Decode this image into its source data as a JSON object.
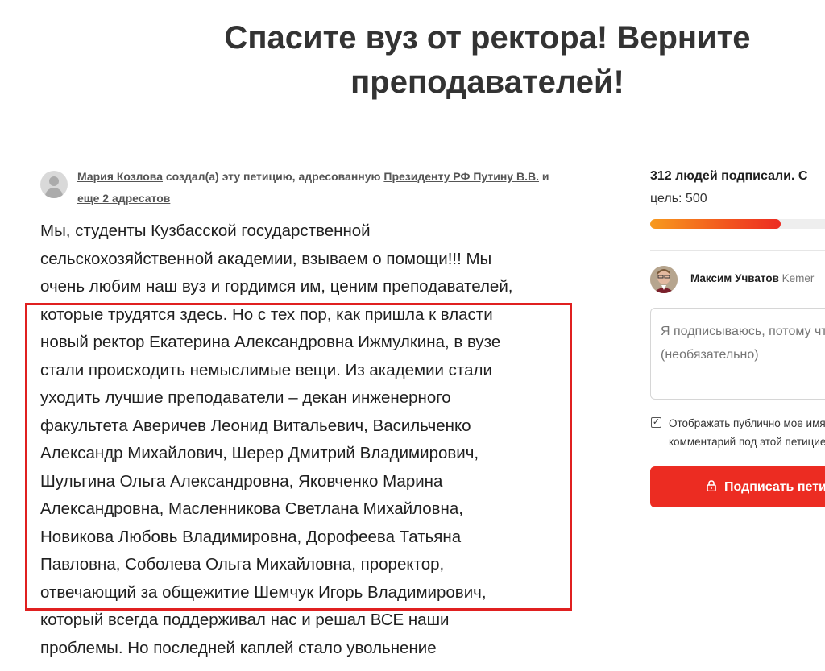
{
  "title": {
    "line1": "Спасите вуз от ректора! Верните",
    "line2": "преподавателей!"
  },
  "byline": {
    "author": "Мария Козлова",
    "text1": " создал(а) эту петицию, адресованную ",
    "recipient": "Президенту РФ Путину В.В.",
    "text2": " и",
    "more": "еще 2 адресатов"
  },
  "story": {
    "lines": [
      "Мы, студенты Кузбасской государственной",
      "сельскохозяйственной академии, взываем о помощи!!! Мы",
      "очень любим наш вуз и гордимся им, ценим преподавателей,",
      "которые трудятся здесь. Но с тех пор, как пришла к власти",
      "новый ректор Екатерина Александровна Ижмулкина, в вузе",
      "стали происходить немыслимые вещи. Из академии стали",
      "уходить лучшие преподаватели – декан инженерного",
      "факультета Аверичев Леонид Витальевич, Васильченко",
      "Александр Михайлович, Шерер Дмитрий Владимирович,",
      "Шульгина Ольга Александровна, Яковченко Марина",
      "Александровна, Масленникова Светлана Михайловна,",
      "Новикова Любовь Владимировна, Дорофеева Татьяна",
      "Павловна, Соболева Ольга Михайловна, проректор,",
      "отвечающий за общежитие Шемчук Игорь Владимирович,",
      "который всегда поддерживал нас и решал ВСЕ наши",
      "проблемы. Но последней каплей стало увольнение"
    ]
  },
  "sidebar": {
    "signed_text": "312 людей подписали.",
    "signed_tail": " С",
    "goal_text": "цель: 500",
    "signed_count": 312,
    "goal_count": 500,
    "signer_name": "Максим Учватов",
    "signer_location": " Kemer",
    "comment_placeholder": "Я подписываюсь, потому что...\n(необязательно)",
    "checkbox_label": "Отображать публично мое имя и комментарий под этой петицией",
    "checkbox_checked": true,
    "checkbox_mark": "✓",
    "sign_button_label": "Подписать петицию"
  },
  "colors": {
    "accent_red": "#ec2c22",
    "highlight_border": "#e02020",
    "progress_start": "#f79a1e"
  }
}
